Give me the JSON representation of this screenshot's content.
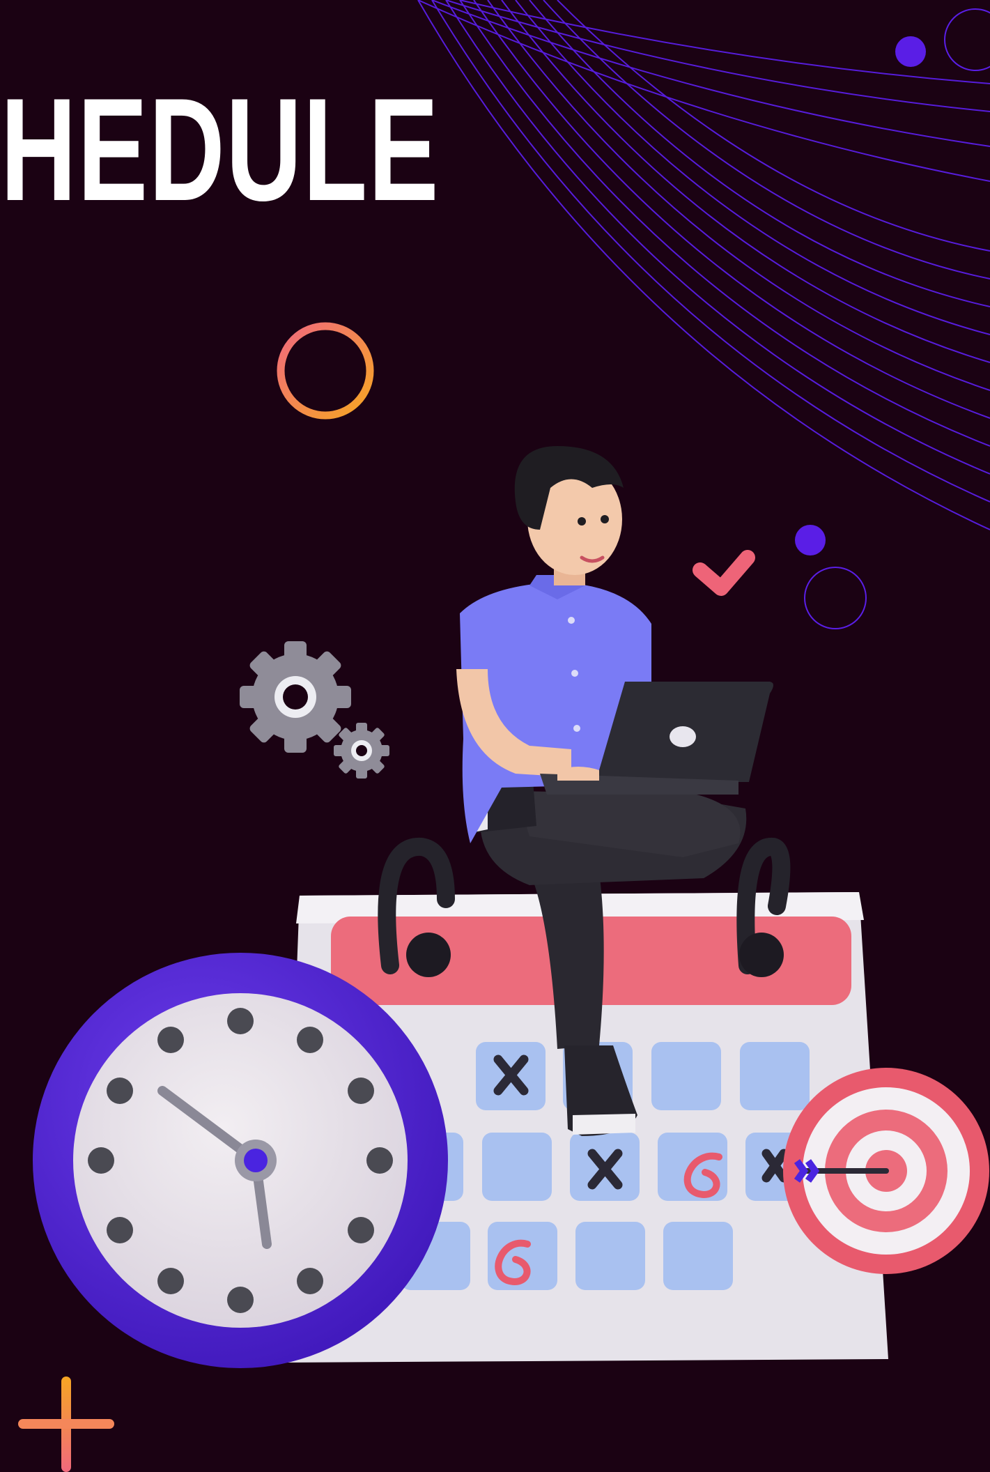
{
  "title": "CHEDULE",
  "colors": {
    "background": "#1b0213",
    "accent_purple": "#5a1ee6",
    "accent_pink": "#f0697d",
    "accent_orange": "#f6a623",
    "shirt_blue": "#7a7bf5",
    "calendar_header": "#ec6c7c",
    "calendar_cell": "#a9c1f0"
  },
  "icons": [
    "gear-icon",
    "checkmark-icon",
    "target-icon",
    "clock-icon",
    "calendar-icon",
    "plus-icon",
    "ring-icon"
  ]
}
